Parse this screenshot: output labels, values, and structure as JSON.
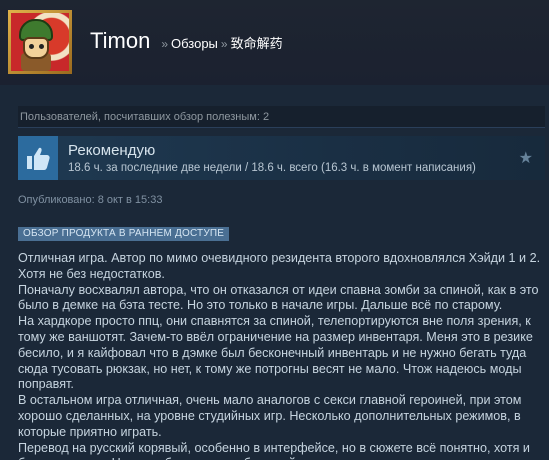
{
  "header": {
    "user_name": "Timon",
    "separator": "»",
    "crumb_reviews": "Обзоры",
    "crumb_game": "致命解药"
  },
  "helpful_text": "Пользователей, посчитавших обзор полезным: 2",
  "recommendation": {
    "title": "Рекомендую",
    "hours_recent": "18.6 ч. за последние две недели",
    "hours_divider": " / ",
    "hours_total": "18.6 ч. всего",
    "hours_at_review": " (16.3 ч. в момент написания)",
    "thumb_icon": "thumbs-up-icon",
    "star_icon": "award-star-icon"
  },
  "posted": "Опубликовано: 8 окт в 15:33",
  "badge": "ОБЗОР ПРОДУКТА В РАННЕМ ДОСТУПЕ",
  "review_paragraphs": [
    "Отличная игра. Автор по мимо очевидного резидента второго вдохновлялся Хэйди 1 и 2. Хотя не без недостатков.",
    "Поначалу восхвалял автора, что он отказался от идеи спавна зомби за спиной, как в это было в демке на бэта тесте. Но это только в начале игры. Дальше всё по старому.",
    "На хардкоре просто ппц, они спавнятся за спиной, телепортируются вне поля зрения, к тому же ваншотят. Зачем-то ввёл ограничение на размер инвентаря. Меня это в резике бесило, и я кайфовал что в дэмке был бесконечный инвентарь и не нужно бегать туда сюда тусовать рюкзак, но нет, к тому же потрогны весят не мало. Чтож надеюсь моды поправят.",
    "В остальном игра отличная, очень мало аналогов с секси главной героиней, при этом хорошо сделанных, на уровне студийных игр. Несколько дополнительных режимов, в которые приятно играть.",
    "Перевод на русский корявый, особенно в интерфейсе, но в сюжете всё понятно, хотя и бывают косяки. Но спасибо, что хотся бы такой есть и не нужно лезть в переводчик."
  ],
  "colors": {
    "background": "#1b2838",
    "accent": "#4a6f93",
    "thumb_bg": "#2c6b9e"
  }
}
